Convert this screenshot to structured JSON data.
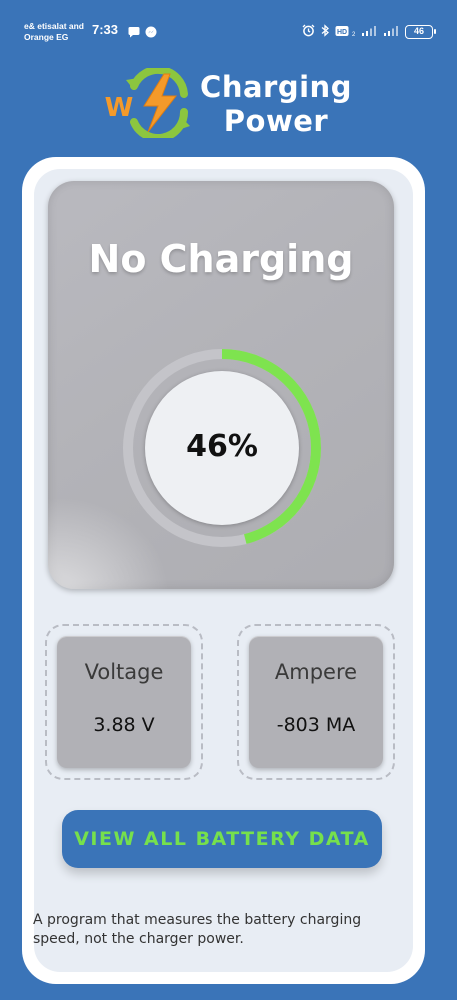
{
  "status_bar": {
    "carrier_line1": "e& etisalat and",
    "carrier_line2": "Orange EG",
    "time": "7:33",
    "battery_level": "46",
    "left_icons": [
      "chat-bubble-icon",
      "messenger-icon"
    ],
    "right_icons": [
      "alarm-icon",
      "bluetooth-icon",
      "hd-voice-icon",
      "signal-icon",
      "signal-icon",
      "battery-icon"
    ]
  },
  "app_header": {
    "title_line1": "Charging",
    "title_line2": "Power",
    "logo_icon": "w-lightning-refresh-logo-icon"
  },
  "charge_panel": {
    "status_title": "No Charging",
    "percent_text": "46%",
    "percent_value": 0.46,
    "progress_color": "#7ee34f",
    "track_color": "#c4c4c9"
  },
  "stats": {
    "voltage_label": "Voltage",
    "voltage_value": "3.88 V",
    "ampere_label": "Ampere",
    "ampere_value": "-803 MA"
  },
  "cta": {
    "label": "VIEW ALL BATTERY DATA"
  },
  "footer": {
    "note": "A program that measures the battery charging speed, not the charger power."
  },
  "colors": {
    "background": "#3a74b8",
    "button_text": "#76e04c",
    "logo_orange": "#f49a2a",
    "logo_green": "#8cc63f"
  }
}
